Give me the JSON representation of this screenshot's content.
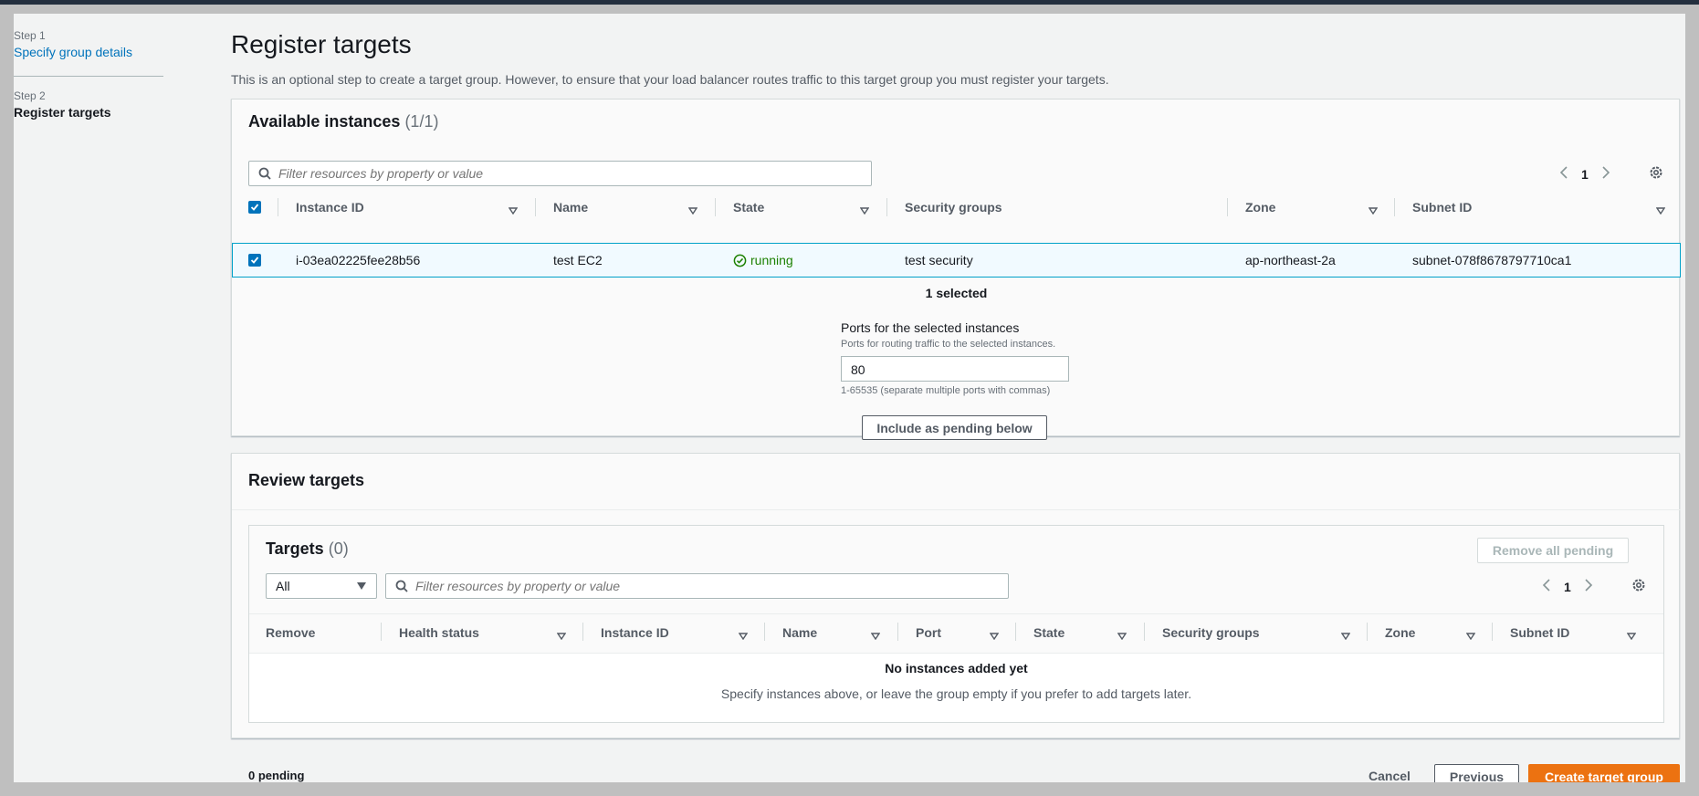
{
  "sidenav": {
    "step1_label": "Step 1",
    "step1_link": "Specify group details",
    "step2_label": "Step 2",
    "step2_current": "Register targets"
  },
  "header": {
    "title": "Register targets",
    "description": "This is an optional step to create a target group. However, to ensure that your load balancer routes traffic to this target group you must register your targets."
  },
  "available": {
    "title": "Available instances",
    "count": "(1/1)",
    "search_placeholder": "Filter resources by property or value",
    "page": "1",
    "columns": [
      "Instance ID",
      "Name",
      "State",
      "Security groups",
      "Zone",
      "Subnet ID"
    ],
    "row": {
      "instance_id": "i-03ea02225fee28b56",
      "name": "test EC2",
      "state": "running",
      "security_groups": "test security",
      "zone": "ap-northeast-2a",
      "subnet_id": "subnet-078f8678797710ca1"
    },
    "selected_text": "1 selected",
    "ports_label": "Ports for the selected instances",
    "ports_desc": "Ports for routing traffic to the selected instances.",
    "ports_value": "80",
    "ports_hint": "1-65535 (separate multiple ports with commas)",
    "include_button": "Include as pending below"
  },
  "review": {
    "title": "Review targets",
    "targets_title": "Targets",
    "targets_count": "(0)",
    "remove_all_button": "Remove all pending",
    "filter_select": "All",
    "search_placeholder": "Filter resources by property or value",
    "page": "1",
    "columns": [
      "Remove",
      "Health status",
      "Instance ID",
      "Name",
      "Port",
      "State",
      "Security groups",
      "Zone",
      "Subnet ID"
    ],
    "empty_title": "No instances added yet",
    "empty_desc": "Specify instances above, or leave the group empty if you prefer to add targets later."
  },
  "footer": {
    "pending": "0 pending",
    "cancel": "Cancel",
    "previous": "Previous",
    "create": "Create target group"
  },
  "colors": {
    "primary": "#ec7211",
    "link": "#0073bb",
    "running": "#1d8102"
  }
}
